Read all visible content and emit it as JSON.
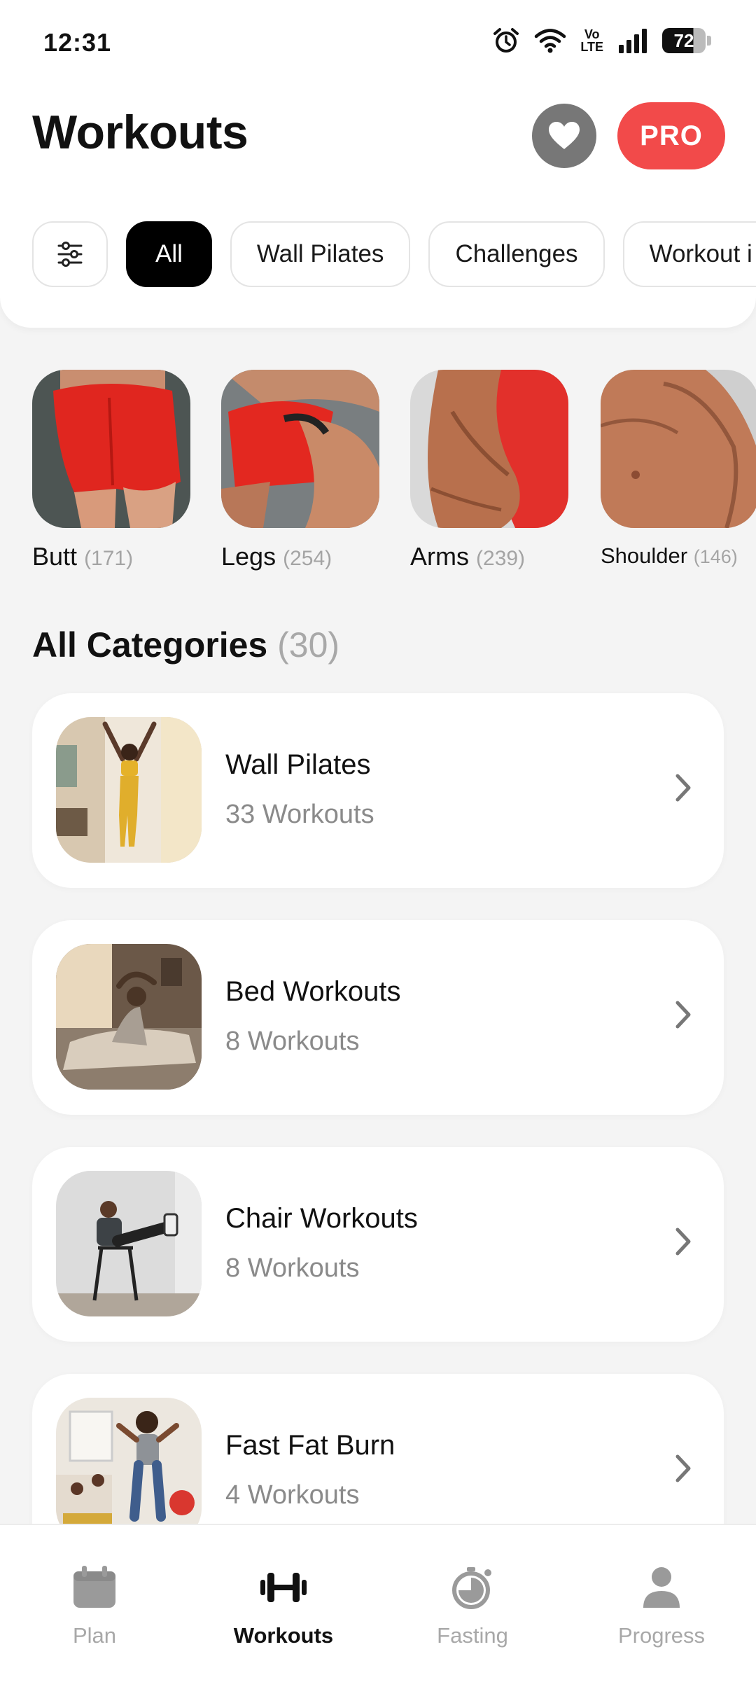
{
  "status_bar": {
    "time": "12:31",
    "volte_top": "Vo",
    "volte_bottom": "LTE",
    "battery": "72"
  },
  "header": {
    "title": "Workouts",
    "pro_label": "PRO"
  },
  "filters": {
    "chips": [
      "All",
      "Wall Pilates",
      "Challenges",
      "Workout i"
    ],
    "selected": "All"
  },
  "body_parts": [
    {
      "label": "Butt",
      "count": "(171)"
    },
    {
      "label": "Legs",
      "count": "(254)"
    },
    {
      "label": "Arms",
      "count": "(239)"
    },
    {
      "label": "Shoulder",
      "count": "(146)"
    }
  ],
  "categories": {
    "title": "All Categories",
    "count": "(30)",
    "items": [
      {
        "title": "Wall Pilates",
        "subtitle": "33 Workouts"
      },
      {
        "title": "Bed Workouts",
        "subtitle": "8 Workouts"
      },
      {
        "title": "Chair Workouts",
        "subtitle": "8 Workouts"
      },
      {
        "title": "Fast Fat Burn",
        "subtitle": "4 Workouts"
      }
    ]
  },
  "bottom_nav": {
    "items": [
      "Plan",
      "Workouts",
      "Fasting",
      "Progress"
    ],
    "active": "Workouts"
  },
  "colors": {
    "accent": "#f24a4a",
    "active_chip": "#000000",
    "background": "#f4f4f4"
  }
}
